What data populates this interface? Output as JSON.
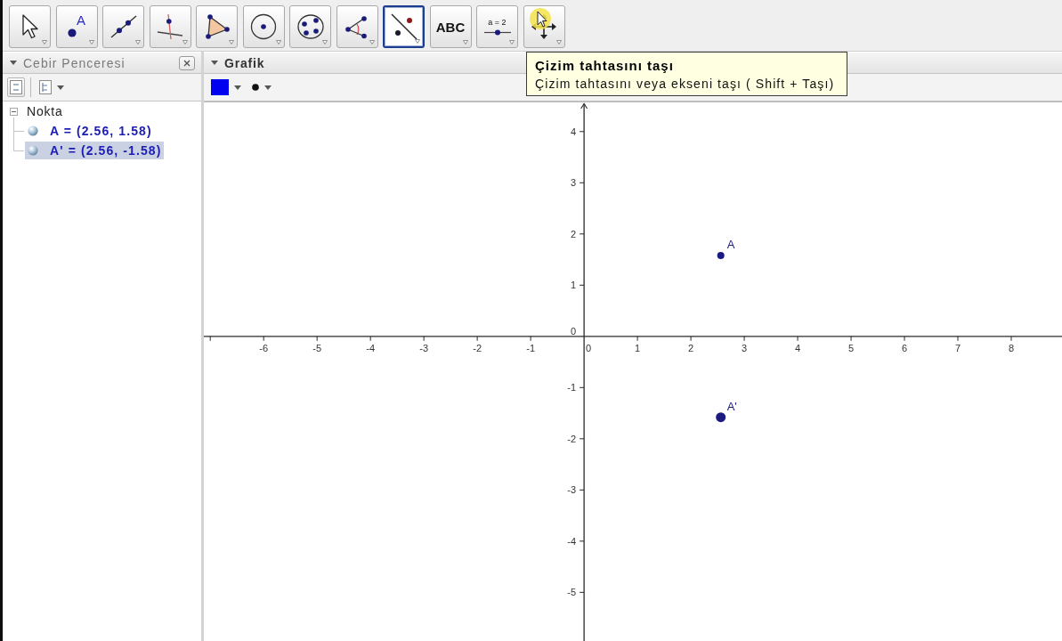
{
  "toolbar": {
    "tools": [
      {
        "kind": "move",
        "selected": false
      },
      {
        "kind": "point",
        "label": "A",
        "selected": false
      },
      {
        "kind": "line",
        "selected": false
      },
      {
        "kind": "perpendicular",
        "selected": false
      },
      {
        "kind": "polygon",
        "selected": false
      },
      {
        "kind": "circle",
        "selected": false
      },
      {
        "kind": "conic",
        "selected": false
      },
      {
        "kind": "angle",
        "selected": false
      },
      {
        "kind": "reflect",
        "selected": true
      },
      {
        "kind": "text",
        "label": "ABC",
        "selected": false
      },
      {
        "kind": "slider",
        "label": "a = 2",
        "selected": false
      },
      {
        "kind": "move-view",
        "selected": false
      }
    ]
  },
  "tooltip": {
    "title": "Çizim tahtasını taşı",
    "text": "Çizim tahtasını veya ekseni taşı ( Shift + Taşı)"
  },
  "algebra_view": {
    "title": "Cebir Penceresi",
    "groups": [
      {
        "label": "Nokta",
        "expanded": true,
        "children": [
          {
            "text": "A = (2.56, 1.58)",
            "selected": false
          },
          {
            "text": "A' = (2.56, -1.58)",
            "selected": true
          }
        ]
      }
    ]
  },
  "graphics_view": {
    "title": "Grafik",
    "chart_data": {
      "type": "scatter",
      "x": [
        2.56
      ],
      "series": [
        {
          "name": "A",
          "color": "#1a1a80",
          "values": [
            1.58
          ]
        },
        {
          "name": "A'",
          "color": "#1a1a80",
          "values": [
            -1.58
          ]
        }
      ],
      "xlim": [
        -7.12,
        8.95
      ],
      "ylim": [
        -5.95,
        4.57
      ],
      "xticks": [
        -6,
        -5,
        -4,
        -3,
        -2,
        -1,
        0,
        1,
        2,
        3,
        4,
        5,
        6,
        7,
        8
      ],
      "yticks": [
        -5,
        -4,
        -3,
        -2,
        -1,
        0,
        1,
        2,
        3,
        4
      ]
    }
  }
}
